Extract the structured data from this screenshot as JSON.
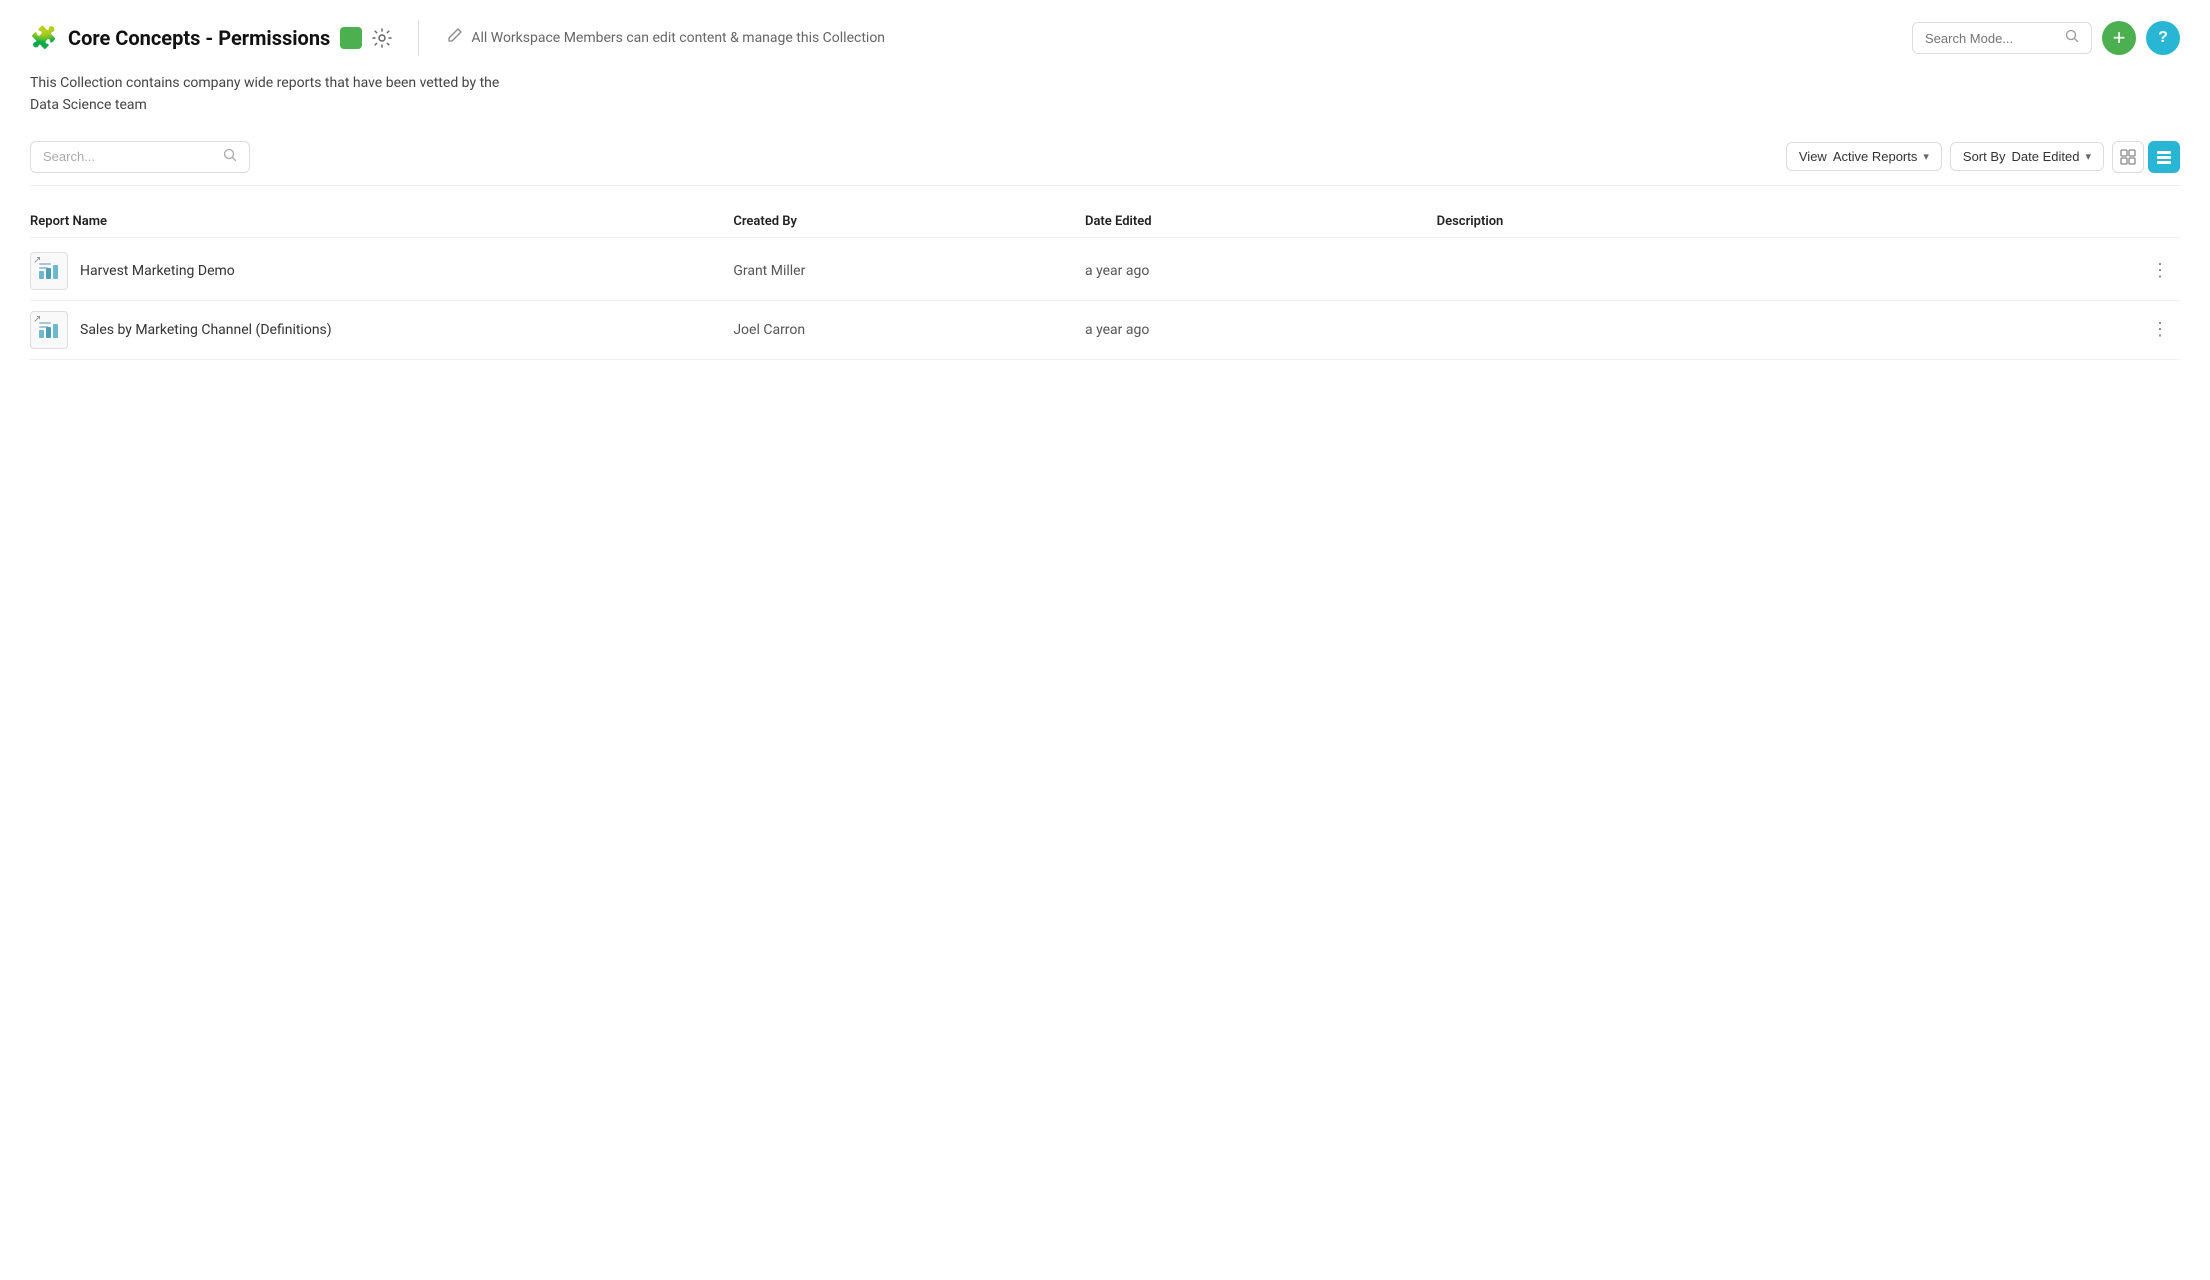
{
  "header": {
    "collection_icon": "🧩",
    "title": "Core Concepts - Permissions",
    "color_swatch": "#4caf50",
    "permissions_text": "All Workspace Members can edit content & manage this Collection",
    "search_mode_placeholder": "Search Mode...",
    "btn_add_label": "+",
    "btn_help_label": "?"
  },
  "description": {
    "line1": "This Collection contains company wide reports that have been vetted by the",
    "line2": "Data Science team"
  },
  "toolbar": {
    "search_placeholder": "Search...",
    "view_active_label": "View Active Reports",
    "sort_by_label": "Sort By Date Edited",
    "sort_by_prefix": "Sort By",
    "sort_by_value": "Date Edited",
    "view_active_prefix": "View",
    "view_active_value": "Active Reports"
  },
  "table": {
    "columns": [
      "Report Name",
      "Created By",
      "Date Edited",
      "Description"
    ],
    "rows": [
      {
        "id": 1,
        "name": "Harvest Marketing Demo",
        "created_by": "Grant Miller",
        "date_edited": "a year ago",
        "description": ""
      },
      {
        "id": 2,
        "name": "Sales by Marketing Channel (Definitions)",
        "created_by": "Joel Carron",
        "date_edited": "a year ago",
        "description": ""
      }
    ]
  }
}
